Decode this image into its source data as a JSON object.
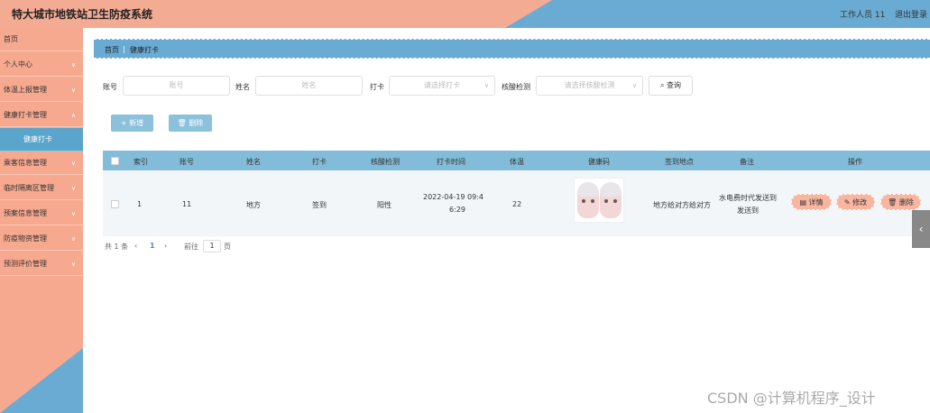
{
  "header": {
    "title": "特大城市地铁站卫生防疫系统",
    "user": "工作人员 11",
    "logout": "退出登录"
  },
  "sidebar": {
    "items": [
      {
        "label": "首页"
      },
      {
        "label": "个人中心"
      },
      {
        "label": "体温上报管理"
      },
      {
        "label": "健康打卡管理"
      },
      {
        "label": "健康打卡"
      },
      {
        "label": "乘客信息管理"
      },
      {
        "label": "临时隔离区管理"
      },
      {
        "label": "预案信息管理"
      },
      {
        "label": "防疫物资管理"
      },
      {
        "label": "预测评价管理"
      }
    ]
  },
  "breadcrumb": {
    "home": "首页",
    "sep": "|",
    "current": "健康打卡"
  },
  "search": {
    "account_label": "账号",
    "account_placeholder": "账号",
    "name_label": "姓名",
    "name_placeholder": "姓名",
    "checkin_label": "打卡",
    "checkin_placeholder": "请选择打卡",
    "nucleic_label": "核酸检测",
    "nucleic_placeholder": "请选择核酸检测",
    "query_label": "查询"
  },
  "actions": {
    "add": "新增",
    "delete": "删除"
  },
  "table": {
    "headers": [
      "索引",
      "账号",
      "姓名",
      "打卡",
      "核酸检测",
      "打卡时间",
      "体温",
      "健康码",
      "签到地点",
      "备注",
      "操作"
    ],
    "rows": [
      {
        "index": "1",
        "account": "11",
        "name": "地方",
        "checkin": "签到",
        "nucleic": "阳性",
        "time_line1": "2022-04-19 09:4",
        "time_line2": "6:29",
        "temperature": "22",
        "location": "地方给对方给对方",
        "remark_line1": "水电费时代发送到",
        "remark_line2": "发送到",
        "op_detail": "详情",
        "op_edit": "修改",
        "op_delete": "删除"
      }
    ]
  },
  "pager": {
    "total": "共 1 条",
    "prev": "‹",
    "page": "1",
    "next": "›",
    "goto": "前往",
    "goto_value": "1",
    "unit": "页"
  },
  "side_tab": "‹",
  "watermark": "CSDN @计算机程序_设计",
  "colors": {
    "header_salmon": "#f4ab93",
    "accent_blue": "#6aabd3",
    "sidebar": "#f7a98f",
    "op_button": "#f8b5a0"
  }
}
